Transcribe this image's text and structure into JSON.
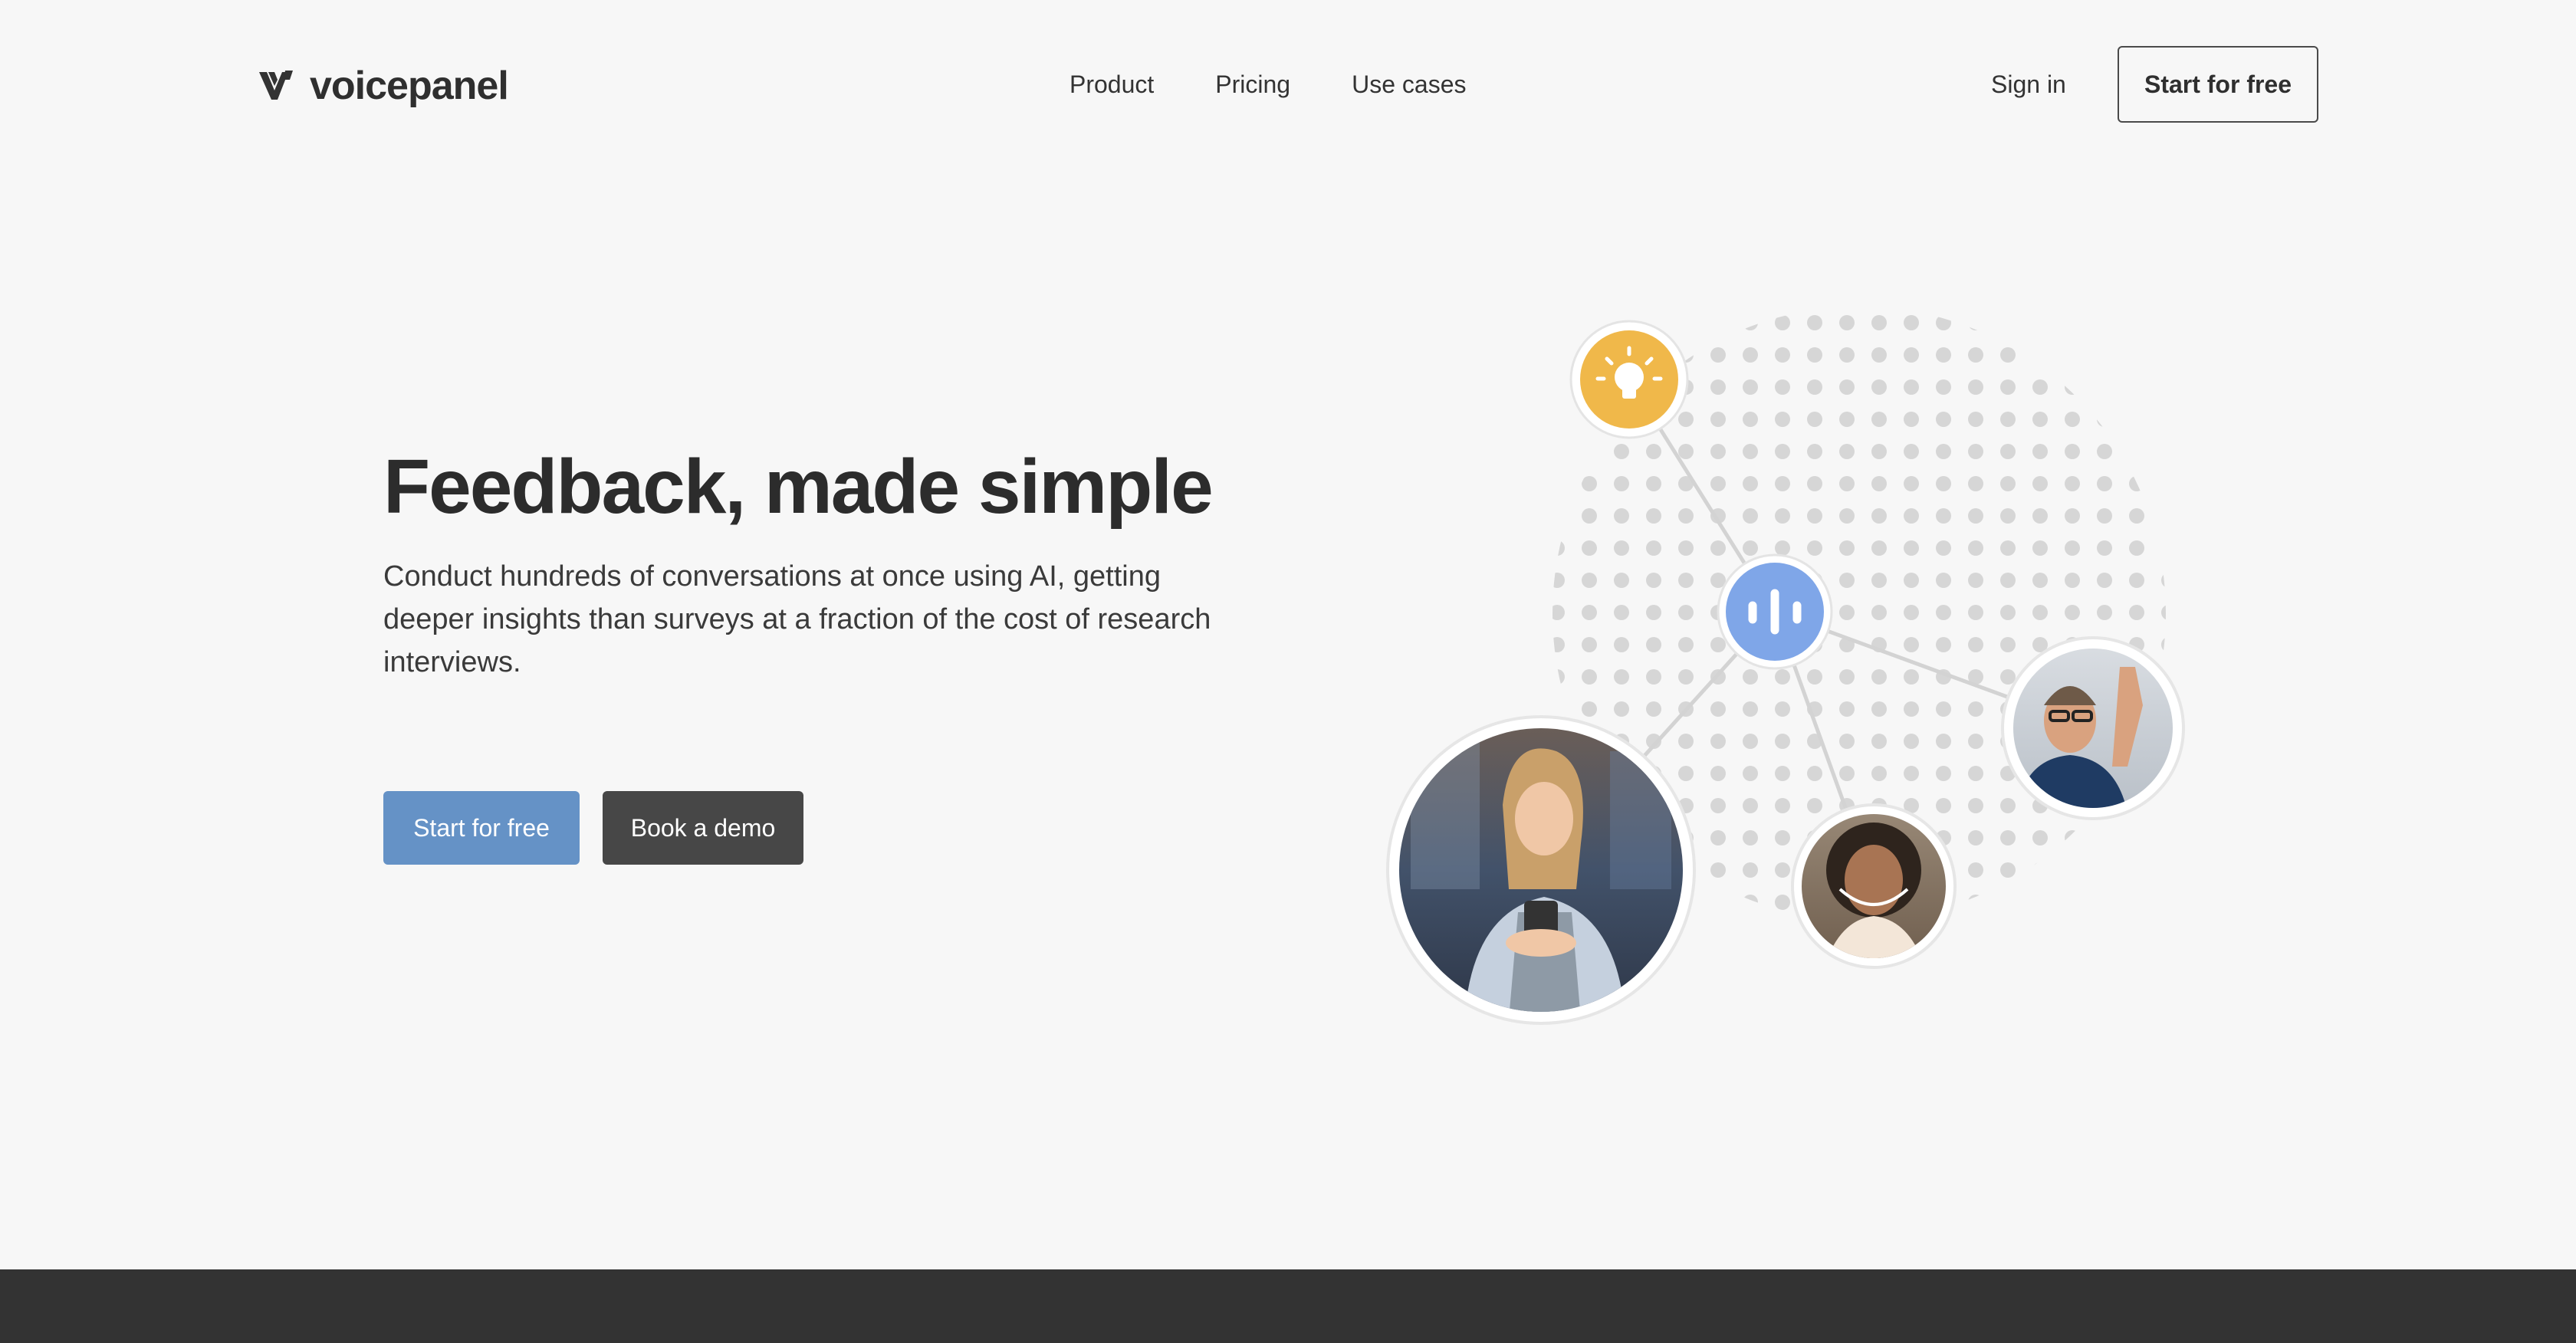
{
  "brand": {
    "name": "voicepanel"
  },
  "nav": {
    "items": [
      {
        "label": "Product"
      },
      {
        "label": "Pricing"
      },
      {
        "label": "Use cases"
      }
    ],
    "sign_in": "Sign in",
    "start_free": "Start for free"
  },
  "hero": {
    "title": "Feedback, made simple",
    "subtitle": "Conduct hundreds of conversations at once using AI, getting deeper insights than surveys at a fraction of the cost of research interviews.",
    "primary_cta": "Start for free",
    "secondary_cta": "Book a demo"
  },
  "illustration": {
    "nodes": [
      {
        "type": "idea",
        "icon": "lightbulb-icon",
        "color": "#f0b84a"
      },
      {
        "type": "voice",
        "icon": "audio-wave-icon",
        "color": "#7fa6e8"
      },
      {
        "type": "person",
        "icon": "woman-with-phone-avatar"
      },
      {
        "type": "person",
        "icon": "man-waving-avatar"
      },
      {
        "type": "person",
        "icon": "smiling-woman-avatar"
      }
    ]
  },
  "colors": {
    "background": "#f7f7f7",
    "accent_blue": "#6592c6",
    "dark_button": "#474747",
    "footer": "#333333",
    "idea_yellow": "#f0b84a",
    "voice_blue": "#7fa6e8"
  }
}
